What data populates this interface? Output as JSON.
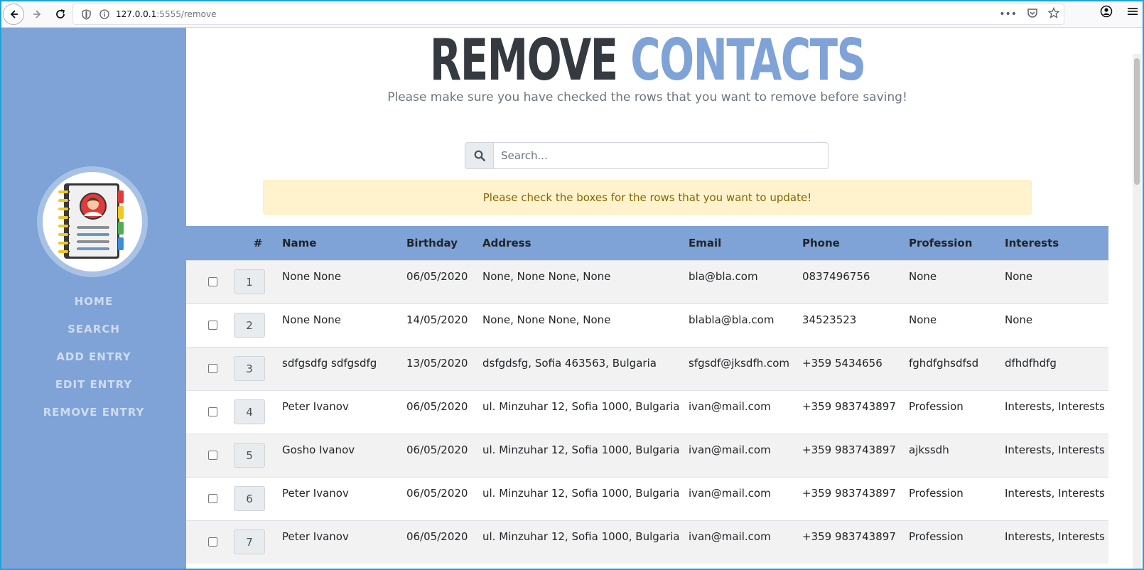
{
  "browser": {
    "url_host": "127.0.0.1",
    "url_rest": ":5555/remove"
  },
  "sidebar": {
    "items": [
      {
        "label": "HOME"
      },
      {
        "label": "SEARCH"
      },
      {
        "label": "ADD ENTRY"
      },
      {
        "label": "EDIT ENTRY"
      },
      {
        "label": "REMOVE ENTRY"
      }
    ]
  },
  "header": {
    "title_part1": "REMOVE",
    "title_part2": "CONTACTS",
    "subtitle": "Please make sure you have checked the rows that you want to remove before saving!"
  },
  "search": {
    "placeholder": "Search..."
  },
  "alert": {
    "text": "Please check the boxes for the rows that you want to update!"
  },
  "table": {
    "columns": [
      "#",
      "Name",
      "Birthday",
      "Address",
      "Email",
      "Phone",
      "Profession",
      "Interests"
    ],
    "rows": [
      {
        "id": "1",
        "name": "None None",
        "birthday": "06/05/2020",
        "address": "None, None None, None",
        "email": "bla@bla.com",
        "phone": "0837496756",
        "profession": "None",
        "interests": "None"
      },
      {
        "id": "2",
        "name": "None None",
        "birthday": "14/05/2020",
        "address": "None, None None, None",
        "email": "blabla@bla.com",
        "phone": "34523523",
        "profession": "None",
        "interests": "None"
      },
      {
        "id": "3",
        "name": "sdfgsdfg sdfgsdfg",
        "birthday": "13/05/2020",
        "address": "dsfgdsfg, Sofia 463563, Bulgaria",
        "email": "sfgsdf@jksdfh.com",
        "phone": "+359 5434656",
        "profession": "fghdfghsdfsd",
        "interests": "dfhdfhdfg"
      },
      {
        "id": "4",
        "name": "Peter Ivanov",
        "birthday": "06/05/2020",
        "address": "ul. Minzuhar 12, Sofia 1000, Bulgaria",
        "email": "ivan@mail.com",
        "phone": "+359 983743897",
        "profession": "Profession",
        "interests": "Interests, Interests"
      },
      {
        "id": "5",
        "name": "Gosho Ivanov",
        "birthday": "06/05/2020",
        "address": "ul. Minzuhar 12, Sofia 1000, Bulgaria",
        "email": "ivan@mail.com",
        "phone": "+359 983743897",
        "profession": "ajkssdh",
        "interests": "Interests, Interests"
      },
      {
        "id": "6",
        "name": "Peter Ivanov",
        "birthday": "06/05/2020",
        "address": "ul. Minzuhar 12, Sofia 1000, Bulgaria",
        "email": "ivan@mail.com",
        "phone": "+359 983743897",
        "profession": "Profession",
        "interests": "Interests, Interests"
      },
      {
        "id": "7",
        "name": "Peter Ivanov",
        "birthday": "06/05/2020",
        "address": "ul. Minzuhar 12, Sofia 1000, Bulgaria",
        "email": "ivan@mail.com",
        "phone": "+359 983743897",
        "profession": "Profession",
        "interests": "Interests, Interests"
      }
    ]
  },
  "colors": {
    "accent": "#7fa3d6",
    "title_dark": "#343a40",
    "alert_bg": "#fff3cd",
    "alert_text": "#856404"
  },
  "icons": {
    "back": "back-arrow-icon",
    "forward": "forward-arrow-icon",
    "reload": "reload-icon",
    "shield": "shield-icon",
    "info": "info-icon",
    "more": "more-dots-icon",
    "pocket": "pocket-icon",
    "bookmark": "star-icon",
    "account": "account-icon",
    "menu": "hamburger-menu-icon",
    "search": "search-icon",
    "logo": "contact-book-icon"
  }
}
